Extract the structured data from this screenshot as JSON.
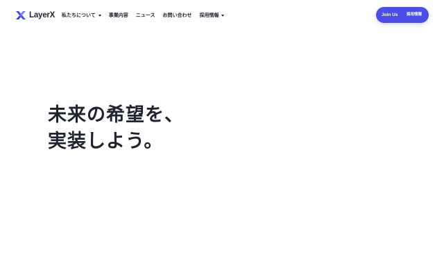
{
  "header": {
    "logo_text": "LayerX",
    "logo_icon": "layerx-logo-icon",
    "nav": [
      {
        "label": "私たちについて",
        "has_dropdown": true
      },
      {
        "label": "事業内容",
        "has_dropdown": false
      },
      {
        "label": "ニュース",
        "has_dropdown": false
      },
      {
        "label": "お問い合わせ",
        "has_dropdown": false
      },
      {
        "label": "採用情報",
        "has_dropdown": true
      }
    ],
    "cta": {
      "join_label": "Join Us",
      "recruit_label": "採用情報"
    }
  },
  "hero": {
    "line1": "未来の希望を、",
    "line2": "実装しよう。"
  },
  "colors": {
    "accent": "#4b4ee8",
    "text": "#1f2430",
    "background": "#ffffff"
  }
}
